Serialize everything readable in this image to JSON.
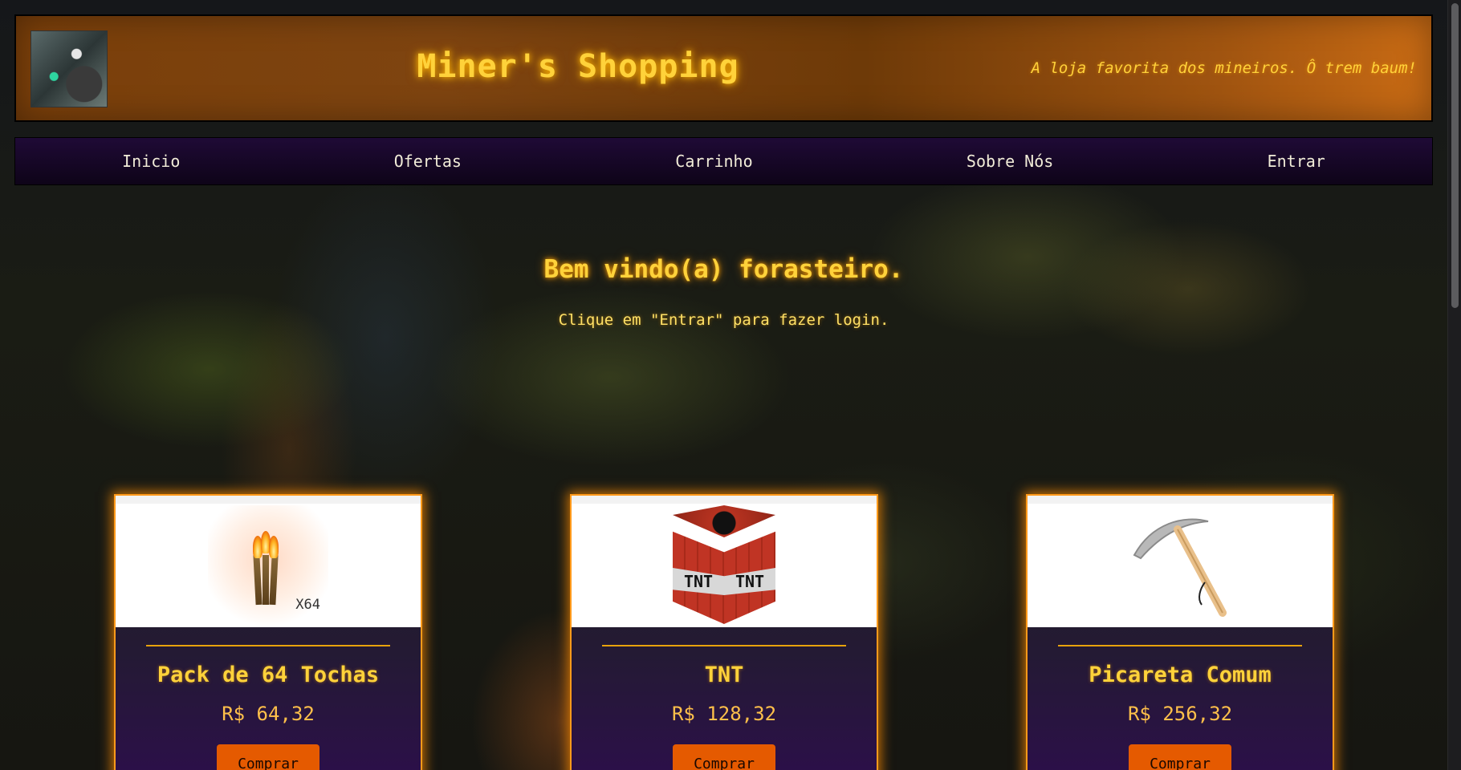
{
  "header": {
    "title": "Miner's Shopping",
    "tagline": "A loja favorita dos mineiros. Ô trem baum!"
  },
  "nav": {
    "items": [
      {
        "label": "Inicio"
      },
      {
        "label": "Ofertas"
      },
      {
        "label": "Carrinho"
      },
      {
        "label": "Sobre Nós"
      },
      {
        "label": "Entrar"
      }
    ]
  },
  "welcome": {
    "title": "Bem vindo(a) forasteiro.",
    "subtitle": "Clique em \"Entrar\" para fazer login."
  },
  "products": [
    {
      "name": "Pack de 64 Tochas",
      "price": "R$ 64,32",
      "button": "Comprar",
      "badge": "X64",
      "icon": "torch-icon"
    },
    {
      "name": "TNT",
      "price": "R$ 128,32",
      "button": "Comprar",
      "badge": "TNT",
      "icon": "tnt-icon"
    },
    {
      "name": "Picareta Comum",
      "price": "R$ 256,32",
      "button": "Comprar",
      "icon": "pickaxe-icon"
    }
  ],
  "colors": {
    "accent": "#ffd23a",
    "header_gradient_start": "#7a3f0a",
    "header_gradient_end": "#c96b14",
    "nav_bg": "#1f0a36",
    "button_bg": "#e55a00",
    "card_glow": "#ff9a1a"
  }
}
